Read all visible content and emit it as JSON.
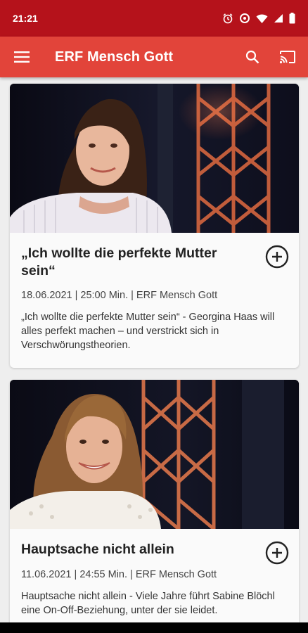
{
  "status_bar": {
    "time": "21:21",
    "icons": [
      "alarm-icon",
      "data-saver-icon",
      "wifi-icon",
      "signal-icon",
      "battery-icon"
    ]
  },
  "app_bar": {
    "title": "ERF Mensch Gott",
    "icons": [
      "menu-icon",
      "search-icon",
      "cast-icon"
    ]
  },
  "cards": [
    {
      "title": "„Ich wollte die perfekte Mutter sein“",
      "meta": "18.06.2021 | 25:00 Min. | ERF Mensch Gott",
      "description": "„Ich wollte die perfekte Mutter sein“ - Georgina Haas will alles perfekt machen – und verstrickt sich in Verschwörungstheorien.",
      "action_icon": "add-circle-icon"
    },
    {
      "title": "Hauptsache nicht allein",
      "meta": "11.06.2021 | 24:55 Min. | ERF Mensch Gott",
      "description": "Hauptsache nicht allein - Viele Jahre führt Sabine Blöchl eine On-Off-Beziehung, unter der sie leidet.",
      "action_icon": "add-circle-icon"
    }
  ],
  "colors": {
    "status_bar": "#b5121b",
    "app_bar": "#e2443a",
    "background": "#eeeeee"
  }
}
